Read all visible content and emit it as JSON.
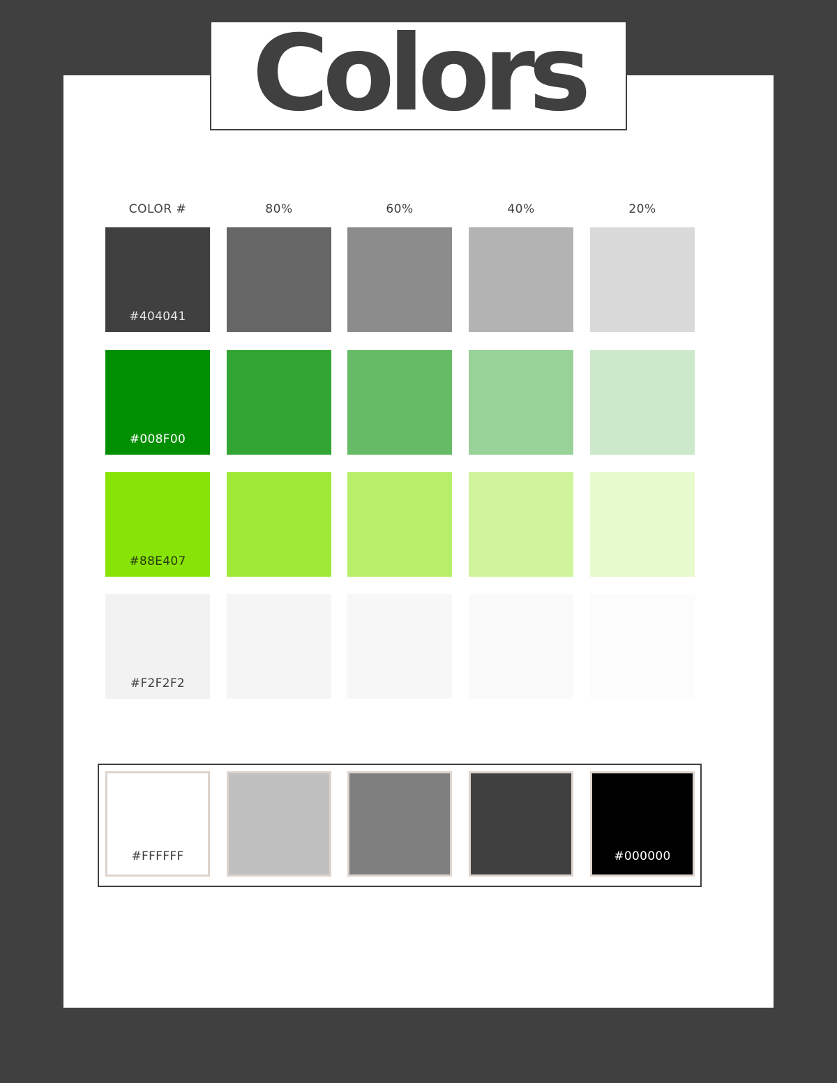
{
  "title": "Colors",
  "column_headers": [
    "COLOR #",
    "80%",
    "60%",
    "40%",
    "20%"
  ],
  "palette_rows": [
    {
      "hex_label": "#404041",
      "label_color": "#e6e6e6",
      "swatches": [
        "#404041",
        "#666667",
        "#8c8c8d",
        "#b3b3b3",
        "#d9d9d9"
      ]
    },
    {
      "hex_label": "#008F00",
      "label_color": "#ffffff",
      "swatches": [
        "#008f00",
        "#33a533",
        "#66bc66",
        "#99d299",
        "#cce9cc"
      ]
    },
    {
      "hex_label": "#88E407",
      "label_color": "#2a3a10",
      "swatches": [
        "#88e407",
        "#a0e939",
        "#b8ef6a",
        "#cff49c",
        "#e7facd"
      ]
    },
    {
      "hex_label": "#F2F2F2",
      "label_color": "#404041",
      "swatches": [
        "#f2f2f2",
        "#f5f5f5",
        "#f7f7f7",
        "#fafafa",
        "#fcfcfc"
      ]
    }
  ],
  "neutrals": [
    {
      "color": "#ffffff",
      "label": "#FFFFFF",
      "label_color": "#404041"
    },
    {
      "color": "#bfbfbf",
      "label": "",
      "label_color": "#404041"
    },
    {
      "color": "#7f7f7f",
      "label": "",
      "label_color": "#ffffff"
    },
    {
      "color": "#404040",
      "label": "",
      "label_color": "#ffffff"
    },
    {
      "color": "#000000",
      "label": "#000000",
      "label_color": "#ffffff"
    }
  ]
}
